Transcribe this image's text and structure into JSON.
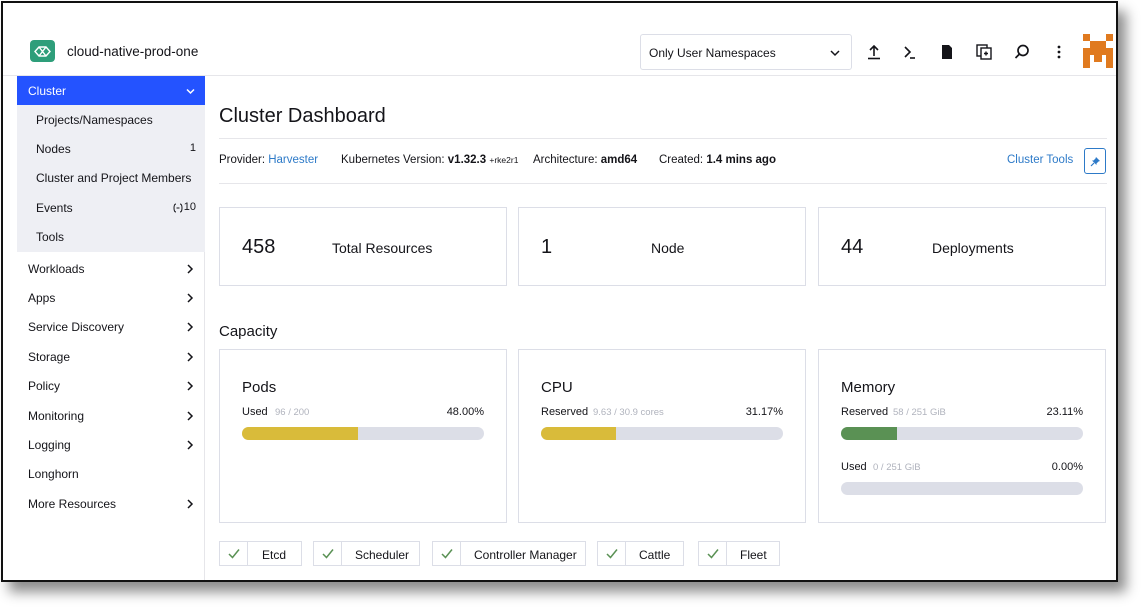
{
  "header": {
    "cluster_name": "cloud-native-prod-one",
    "namespace_filter": "Only User Namespaces",
    "icons": [
      "upload-icon",
      "terminal-icon",
      "file-icon",
      "copy-config-icon",
      "search-icon",
      "more-vertical-icon"
    ]
  },
  "sidebar": {
    "cluster_label": "Cluster",
    "sub_items": [
      {
        "label": "Projects/Namespaces",
        "count": ""
      },
      {
        "label": "Nodes",
        "count": "1"
      },
      {
        "label": "Cluster and Project Members",
        "count": ""
      },
      {
        "label": "Events",
        "count": "10"
      },
      {
        "label": "Tools",
        "count": ""
      }
    ],
    "items": [
      {
        "label": "Workloads"
      },
      {
        "label": "Apps"
      },
      {
        "label": "Service Discovery"
      },
      {
        "label": "Storage"
      },
      {
        "label": "Policy"
      },
      {
        "label": "Monitoring"
      },
      {
        "label": "Logging"
      },
      {
        "label": "Longhorn"
      },
      {
        "label": "More Resources"
      }
    ]
  },
  "main": {
    "title": "Cluster Dashboard",
    "meta": {
      "provider_label": "Provider:",
      "provider_value": "Harvester",
      "k8s_label": "Kubernetes Version:",
      "k8s_value": "v1.32.3",
      "k8s_suffix": "+rke2r1",
      "arch_label": "Architecture:",
      "arch_value": "amd64",
      "created_label": "Created:",
      "created_value": "1.4 mins ago",
      "tools_link": "Cluster Tools"
    },
    "stats": [
      {
        "value": "458",
        "label": "Total Resources"
      },
      {
        "value": "1",
        "label": "Node"
      },
      {
        "value": "44",
        "label": "Deployments"
      }
    ],
    "capacity_title": "Capacity",
    "capacity": {
      "pods": {
        "title": "Pods",
        "label": "Used",
        "detail": "96 / 200",
        "percent": "48.00%",
        "fraction": 0.48,
        "color": "#d9bb3a"
      },
      "cpu": {
        "title": "CPU",
        "label": "Reserved",
        "detail": "9.63 / 30.9 cores",
        "percent": "31.17%",
        "fraction": 0.3117,
        "color": "#d9bb3a"
      },
      "memory_reserved": {
        "title": "Memory",
        "label": "Reserved",
        "detail": "58 / 251 GiB",
        "percent": "23.11%",
        "fraction": 0.2311,
        "color": "#5a9154"
      },
      "memory_used": {
        "label": "Used",
        "detail": "0 / 251 GiB",
        "percent": "0.00%",
        "fraction": 0.0,
        "color": "#5a9154"
      }
    },
    "components": [
      "Etcd",
      "Scheduler",
      "Controller Manager",
      "Cattle",
      "Fleet"
    ]
  },
  "colors": {
    "accent": "#2453ff",
    "link": "#2d7ac8",
    "logo": "#2e9e7a",
    "ok": "#5a9154"
  }
}
